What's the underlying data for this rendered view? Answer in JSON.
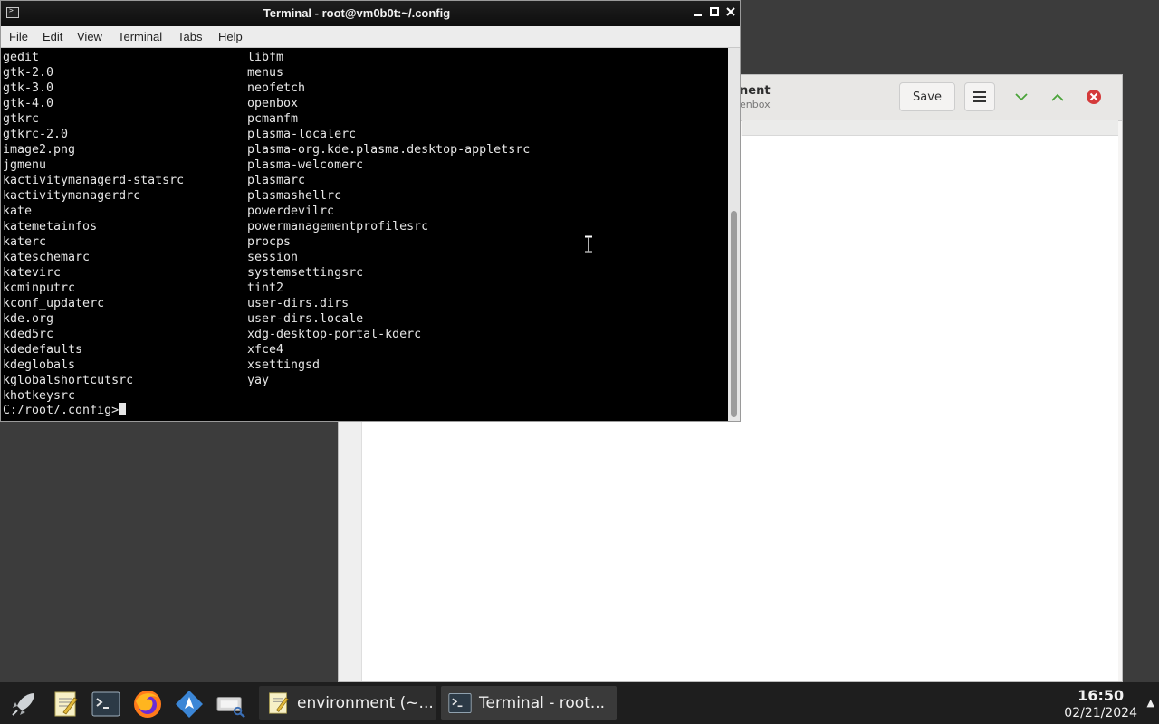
{
  "terminal": {
    "title": "Terminal - root@vm0b0t:~/.config",
    "menu": [
      "File",
      "Edit",
      "View",
      "Terminal",
      "Tabs",
      "Help"
    ],
    "listing_col1": [
      "gedit",
      "gtk-2.0",
      "gtk-3.0",
      "gtk-4.0",
      "gtkrc",
      "gtkrc-2.0",
      "image2.png",
      "jgmenu",
      "kactivitymanagerd-statsrc",
      "kactivitymanagerdrc",
      "kate",
      "katemetainfos",
      "katerc",
      "kateschemarc",
      "katevirc",
      "kcminputrc",
      "kconf_updaterc",
      "kde.org",
      "kded5rc",
      "kdedefaults",
      "kdeglobals",
      "kglobalshortcutsrc",
      "khotkeysrc"
    ],
    "listing_col2": [
      "libfm",
      "menus",
      "neofetch",
      "openbox",
      "pcmanfm",
      "plasma-localerc",
      "plasma-org.kde.plasma.desktop-appletsrc",
      "plasma-welcomerc",
      "plasmarc",
      "plasmashellrc",
      "powerdevilrc",
      "powermanagementprofilesrc",
      "procps",
      "session",
      "systemsettingsrc",
      "tint2",
      "user-dirs.dirs",
      "user-dirs.locale",
      "xdg-desktop-portal-kderc",
      "xfce4",
      "xsettingsd",
      "yay"
    ],
    "prompt": "C:/root/.config>"
  },
  "gedit": {
    "title_fragment": "nent",
    "subtitle_fragment": "enbox",
    "save_label": "Save"
  },
  "taskbar": {
    "launchers": [
      "rocket-icon",
      "text-editor-icon",
      "terminal-icon",
      "firefox-icon",
      "software-icon",
      "screenshot-icon"
    ],
    "tasks": [
      {
        "label": "environment (~...",
        "icon": "text-editor-icon"
      },
      {
        "label": "Terminal - root...",
        "icon": "terminal-icon"
      }
    ],
    "clock": {
      "time": "16:50",
      "date": "02/21/2024"
    }
  },
  "colors": {
    "desktop": "#3c3c3c",
    "taskbar": "#1e1e1e",
    "terminal_bg": "#000000",
    "terminal_fg": "#e6e6e6",
    "close_red": "#d43a3a",
    "nav_green": "#4aa33a"
  }
}
